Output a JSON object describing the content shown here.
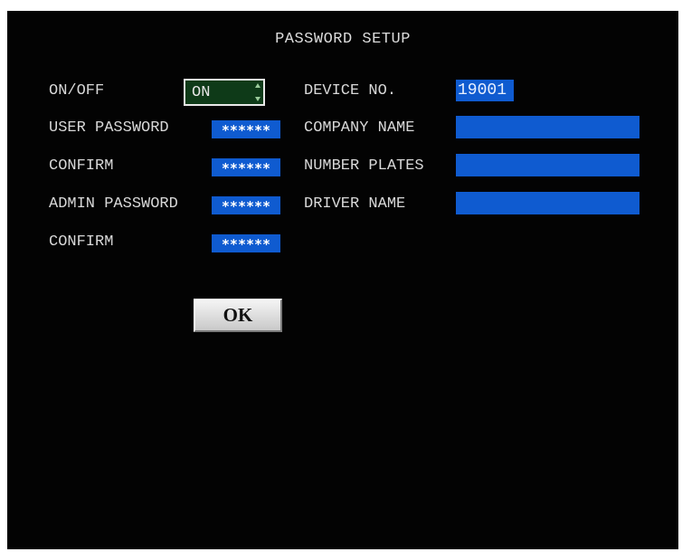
{
  "title": "PASSWORD SETUP",
  "left": {
    "on_off_label": "ON/OFF",
    "on_off_value": "ON",
    "user_password_label": "USER PASSWORD",
    "user_password_value": "******",
    "confirm1_label": "CONFIRM",
    "confirm1_value": "******",
    "admin_password_label": "ADMIN PASSWORD",
    "admin_password_value": "******",
    "confirm2_label": "CONFIRM",
    "confirm2_value": "******"
  },
  "right": {
    "device_no_label": "DEVICE NO.",
    "device_no_value": "19001",
    "company_name_label": "COMPANY NAME",
    "company_name_value": "",
    "number_plates_label": "NUMBER PLATES",
    "number_plates_value": "",
    "driver_name_label": "DRIVER NAME",
    "driver_name_value": ""
  },
  "ok_label": "OK",
  "colors": {
    "background": "#030303",
    "field_blue": "#0f5bd0",
    "toggle_green": "#0e3a18",
    "text": "#d8d8d8"
  }
}
